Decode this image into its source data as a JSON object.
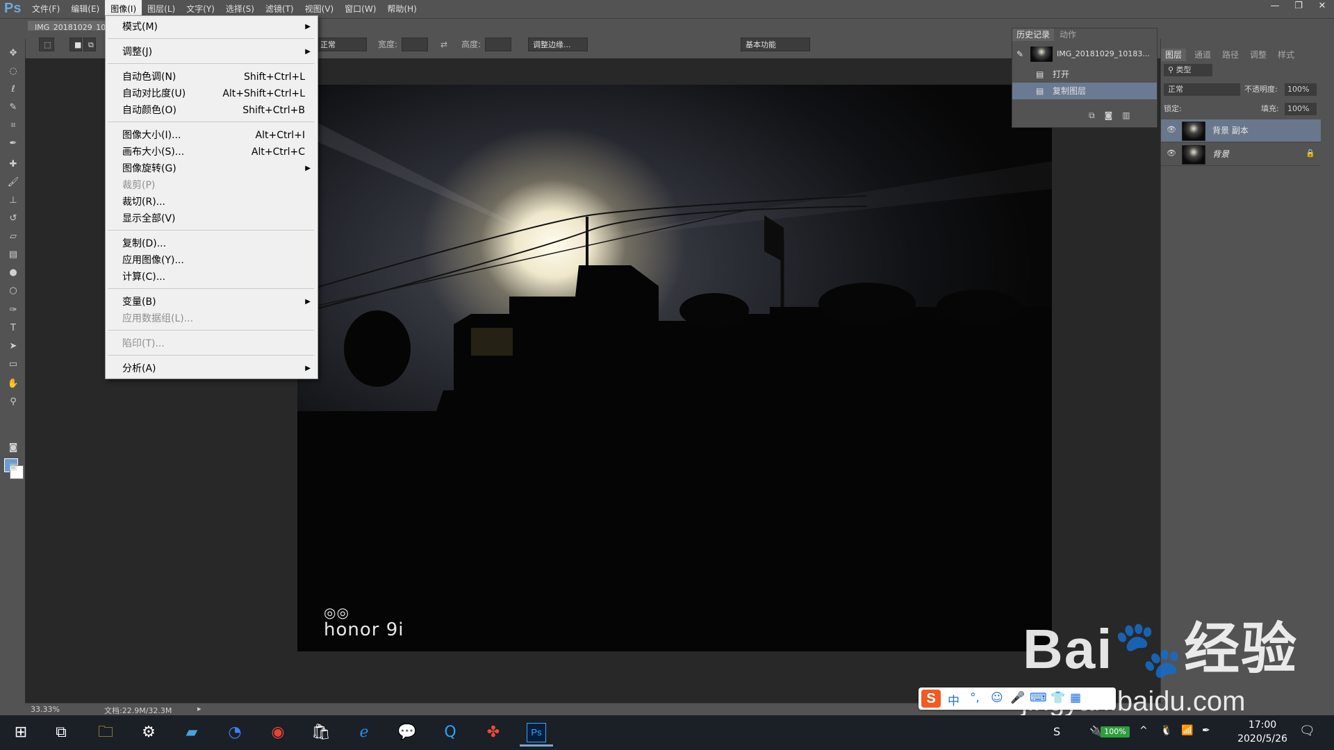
{
  "app": {
    "logo": "Ps"
  },
  "menubar": {
    "items": [
      "文件(F)",
      "编辑(E)",
      "图像(I)",
      "图层(L)",
      "文字(Y)",
      "选择(S)",
      "滤镜(T)",
      "视图(V)",
      "窗口(W)",
      "帮助(H)"
    ],
    "active_index": 2
  },
  "window_controls": {
    "minimize": "—",
    "restore": "❐",
    "close": "✕"
  },
  "document": {
    "tab_title": "IMG_20181029_10"
  },
  "options_bar": {
    "mode_value": "正常",
    "width_label": "宽度:",
    "height_label": "高度:",
    "refine_edge_label": "调整边缘...",
    "workspace_value": "基本功能"
  },
  "image_menu": {
    "items": [
      {
        "label": "模式(M)",
        "shortcut": "",
        "submenu": true,
        "disabled": false
      },
      {
        "label": "调整(J)",
        "shortcut": "",
        "submenu": true,
        "disabled": false
      },
      {
        "label": "自动色调(N)",
        "shortcut": "Shift+Ctrl+L",
        "submenu": false,
        "disabled": false
      },
      {
        "label": "自动对比度(U)",
        "shortcut": "Alt+Shift+Ctrl+L",
        "submenu": false,
        "disabled": false
      },
      {
        "label": "自动颜色(O)",
        "shortcut": "Shift+Ctrl+B",
        "submenu": false,
        "disabled": false
      },
      {
        "label": "图像大小(I)...",
        "shortcut": "Alt+Ctrl+I",
        "submenu": false,
        "disabled": false
      },
      {
        "label": "画布大小(S)...",
        "shortcut": "Alt+Ctrl+C",
        "submenu": false,
        "disabled": false
      },
      {
        "label": "图像旋转(G)",
        "shortcut": "",
        "submenu": true,
        "disabled": false
      },
      {
        "label": "裁剪(P)",
        "shortcut": "",
        "submenu": false,
        "disabled": true
      },
      {
        "label": "裁切(R)...",
        "shortcut": "",
        "submenu": false,
        "disabled": false
      },
      {
        "label": "显示全部(V)",
        "shortcut": "",
        "submenu": false,
        "disabled": false
      },
      {
        "label": "复制(D)...",
        "shortcut": "",
        "submenu": false,
        "disabled": false
      },
      {
        "label": "应用图像(Y)...",
        "shortcut": "",
        "submenu": false,
        "disabled": false
      },
      {
        "label": "计算(C)...",
        "shortcut": "",
        "submenu": false,
        "disabled": false
      },
      {
        "label": "变量(B)",
        "shortcut": "",
        "submenu": true,
        "disabled": false
      },
      {
        "label": "应用数据组(L)...",
        "shortcut": "",
        "submenu": false,
        "disabled": true
      },
      {
        "label": "陷印(T)...",
        "shortcut": "",
        "submenu": false,
        "disabled": true
      },
      {
        "label": "分析(A)",
        "shortcut": "",
        "submenu": true,
        "disabled": false
      }
    ]
  },
  "history_panel": {
    "tabs": [
      "历史记录",
      "动作"
    ],
    "snapshot": "IMG_20181029_10183...",
    "steps": [
      "打开",
      "复制图层"
    ],
    "selected_step": 1
  },
  "layers_panel": {
    "tabs": [
      "图层",
      "通道",
      "路径",
      "调整",
      "样式"
    ],
    "filter_label": "类型",
    "blend_mode": "正常",
    "opacity_label": "不透明度:",
    "opacity_value": "100%",
    "lock_label": "锁定:",
    "fill_label": "填充:",
    "fill_value": "100%",
    "layers": [
      "背景 副本",
      "背景"
    ],
    "selected_layer": 0
  },
  "photo": {
    "watermark_text": "honor 9i",
    "watermark_icon": "dual-camera-icon"
  },
  "status_bar": {
    "zoom": "33.33%",
    "doc_info": "文档:22.9M/32.3M"
  },
  "taskbar": {
    "battery": "100%",
    "time": "17:00",
    "date": "2020/5/26"
  },
  "ime_bar": {
    "mode": "中"
  },
  "watermark": {
    "brand": "Bai",
    "brand_suffix": "经验",
    "url": "jingyan.baidu.com"
  },
  "colors": {
    "menu_bg": "#f0f0f0",
    "panel_bg": "#535353",
    "canvas_bg": "#282828",
    "foreground": "#6b9bd2",
    "background": "#ffffff",
    "selected_row": "#69778c"
  }
}
